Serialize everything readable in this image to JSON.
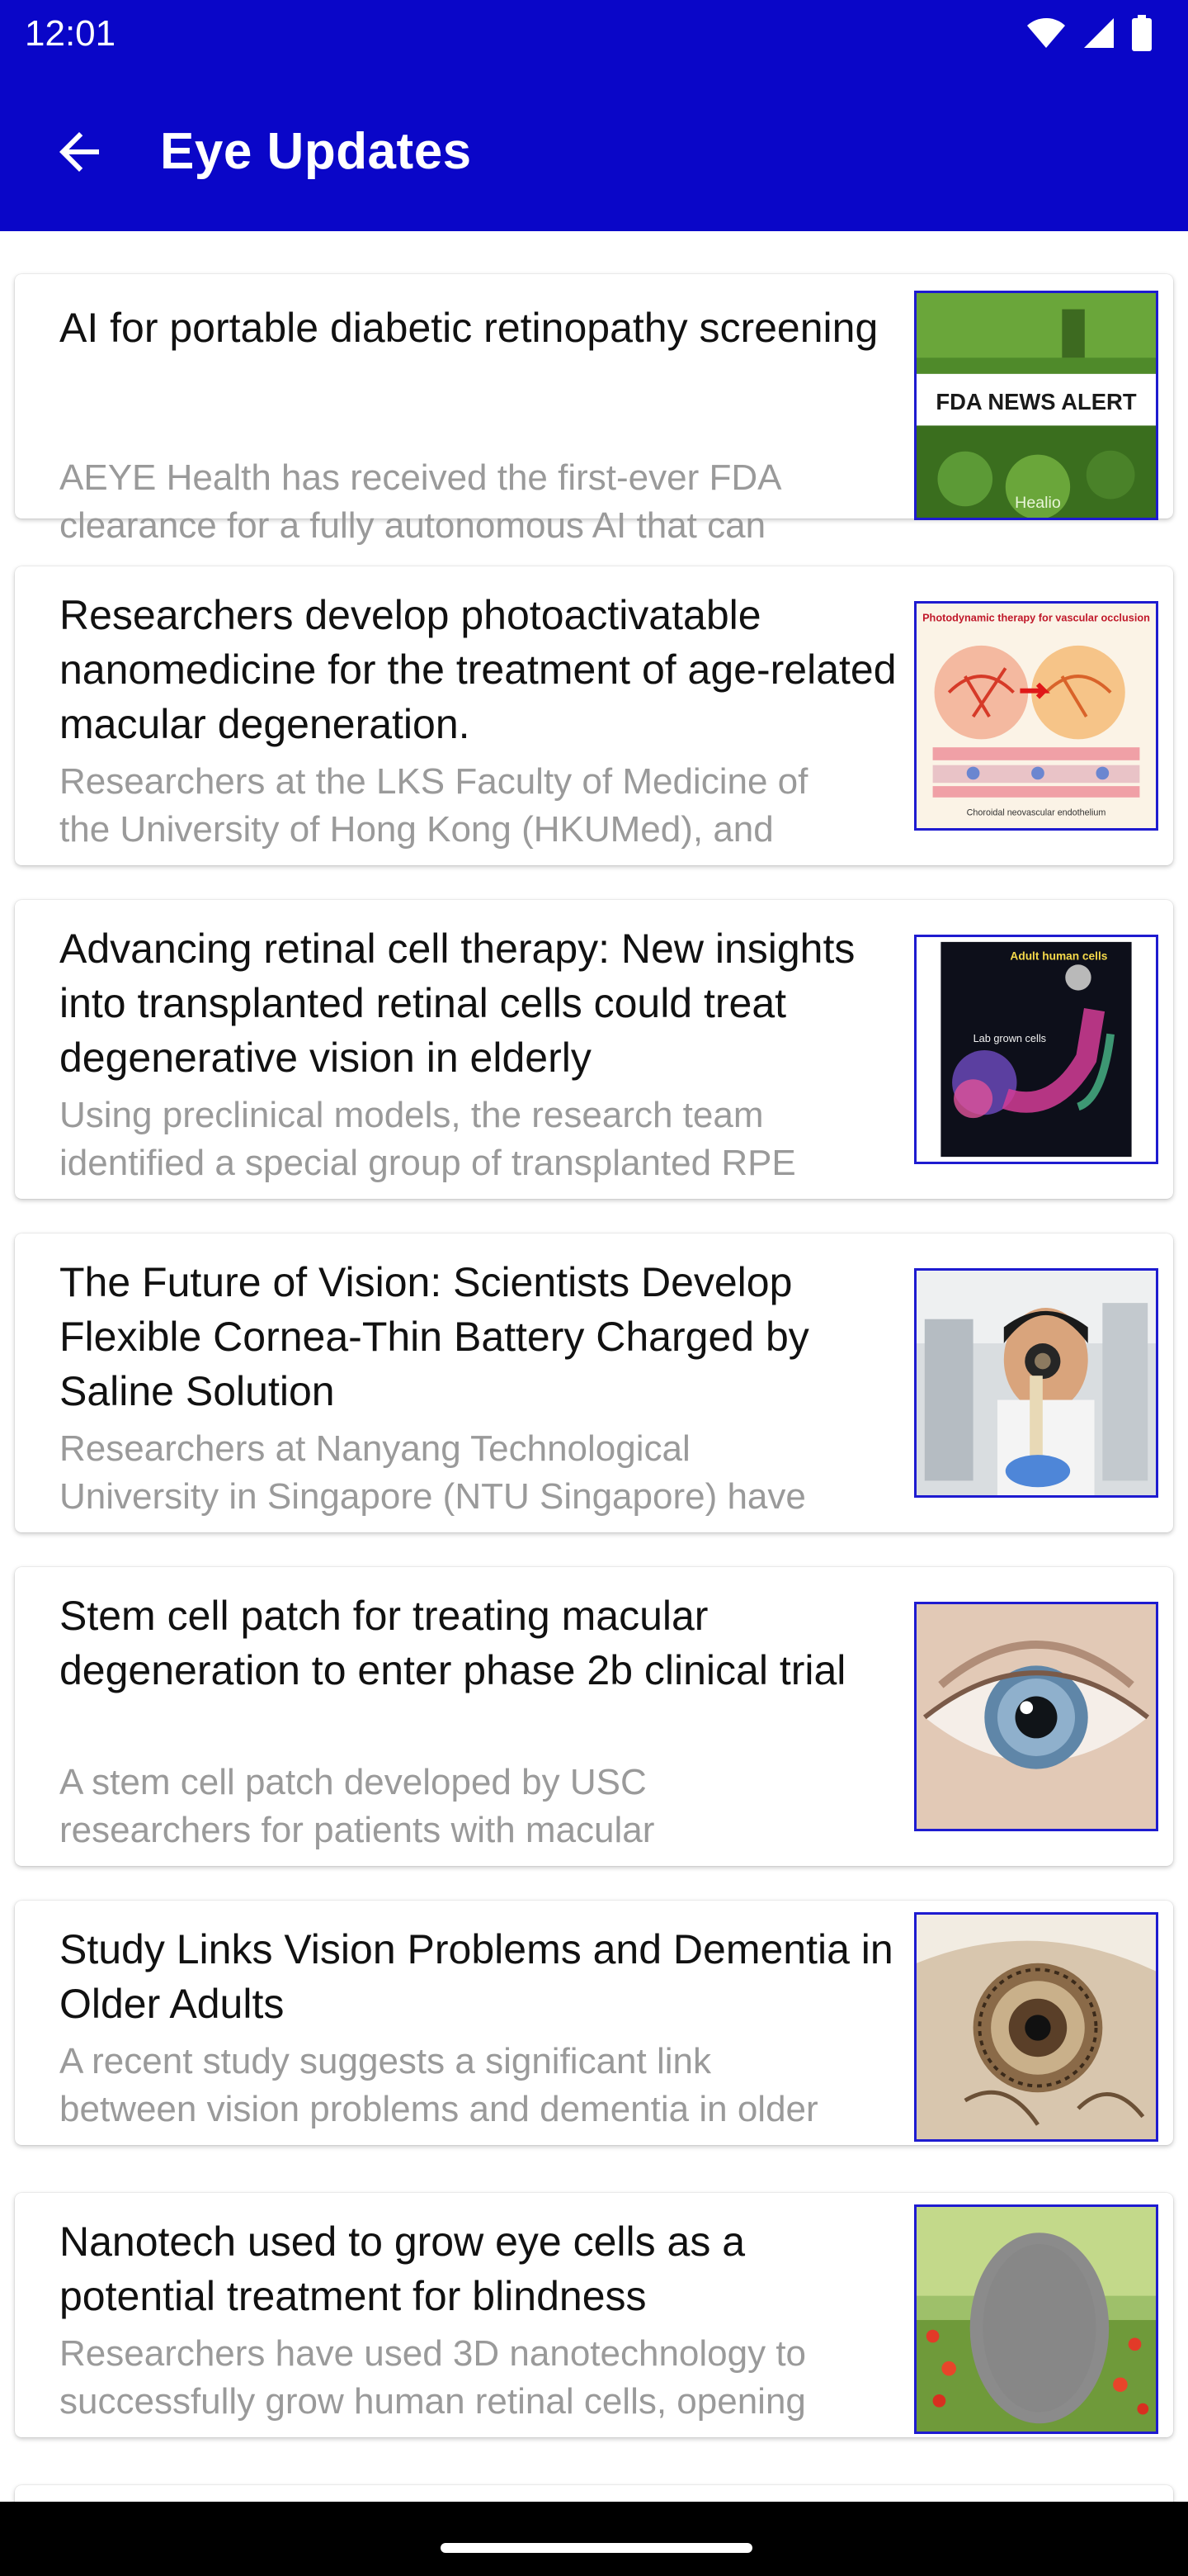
{
  "status_bar": {
    "time": "12:01",
    "icons": [
      "wifi-icon",
      "signal-icon",
      "battery-icon"
    ]
  },
  "app_bar": {
    "title": "Eye Updates",
    "back_icon": "arrow-left-icon",
    "background": "#0a06c8"
  },
  "articles": [
    {
      "title": "AI for portable diabetic retinopathy screening",
      "desc1": "AEYE Health has received the first-ever FDA",
      "desc2": "clearance for a fully autonomous AI that can",
      "thumb_text": "FDA NEWS ALERT",
      "thumb_caption": "Healio"
    },
    {
      "title": "Researchers develop photoactivatable nanomedicine for the treatment of age-related macular degeneration.",
      "desc1": "Researchers at the LKS Faculty of Medicine of",
      "desc2": "the University of Hong Kong (HKUMed), and",
      "thumb_text": "Photodynamic therapy for vascular occlusion",
      "thumb_caption": "Choroidal neovascular endothelium"
    },
    {
      "title": "Advancing retinal cell therapy: New insights into transplanted retinal cells could treat degenerative vision in elderly",
      "desc1": "Using preclinical models, the research team",
      "desc2": "identified a special group of transplanted RPE",
      "thumb_text": "Adult human cells",
      "thumb_caption": "Lab grown cells"
    },
    {
      "title": "The Future of Vision: Scientists Develop Flexible Cornea-Thin Battery Charged by Saline Solution",
      "desc1": "Researchers at Nanyang Technological",
      "desc2": "University in Singapore (NTU Singapore) have"
    },
    {
      "title": "Stem cell patch for treating macular degeneration to enter phase 2b clinical trial",
      "desc1": "A stem cell patch developed by USC",
      "desc2": "researchers for patients with macular"
    },
    {
      "title": "Study Links Vision Problems and Dementia in Older Adults",
      "desc1": "A recent study suggests a significant link",
      "desc2": "between vision problems and dementia in older"
    },
    {
      "title": "Nanotech used to grow eye cells as a potential treatment for blindness",
      "desc1": "Researchers have used 3D nanotechnology to",
      "desc2": "successfully grow human retinal cells, opening"
    }
  ]
}
